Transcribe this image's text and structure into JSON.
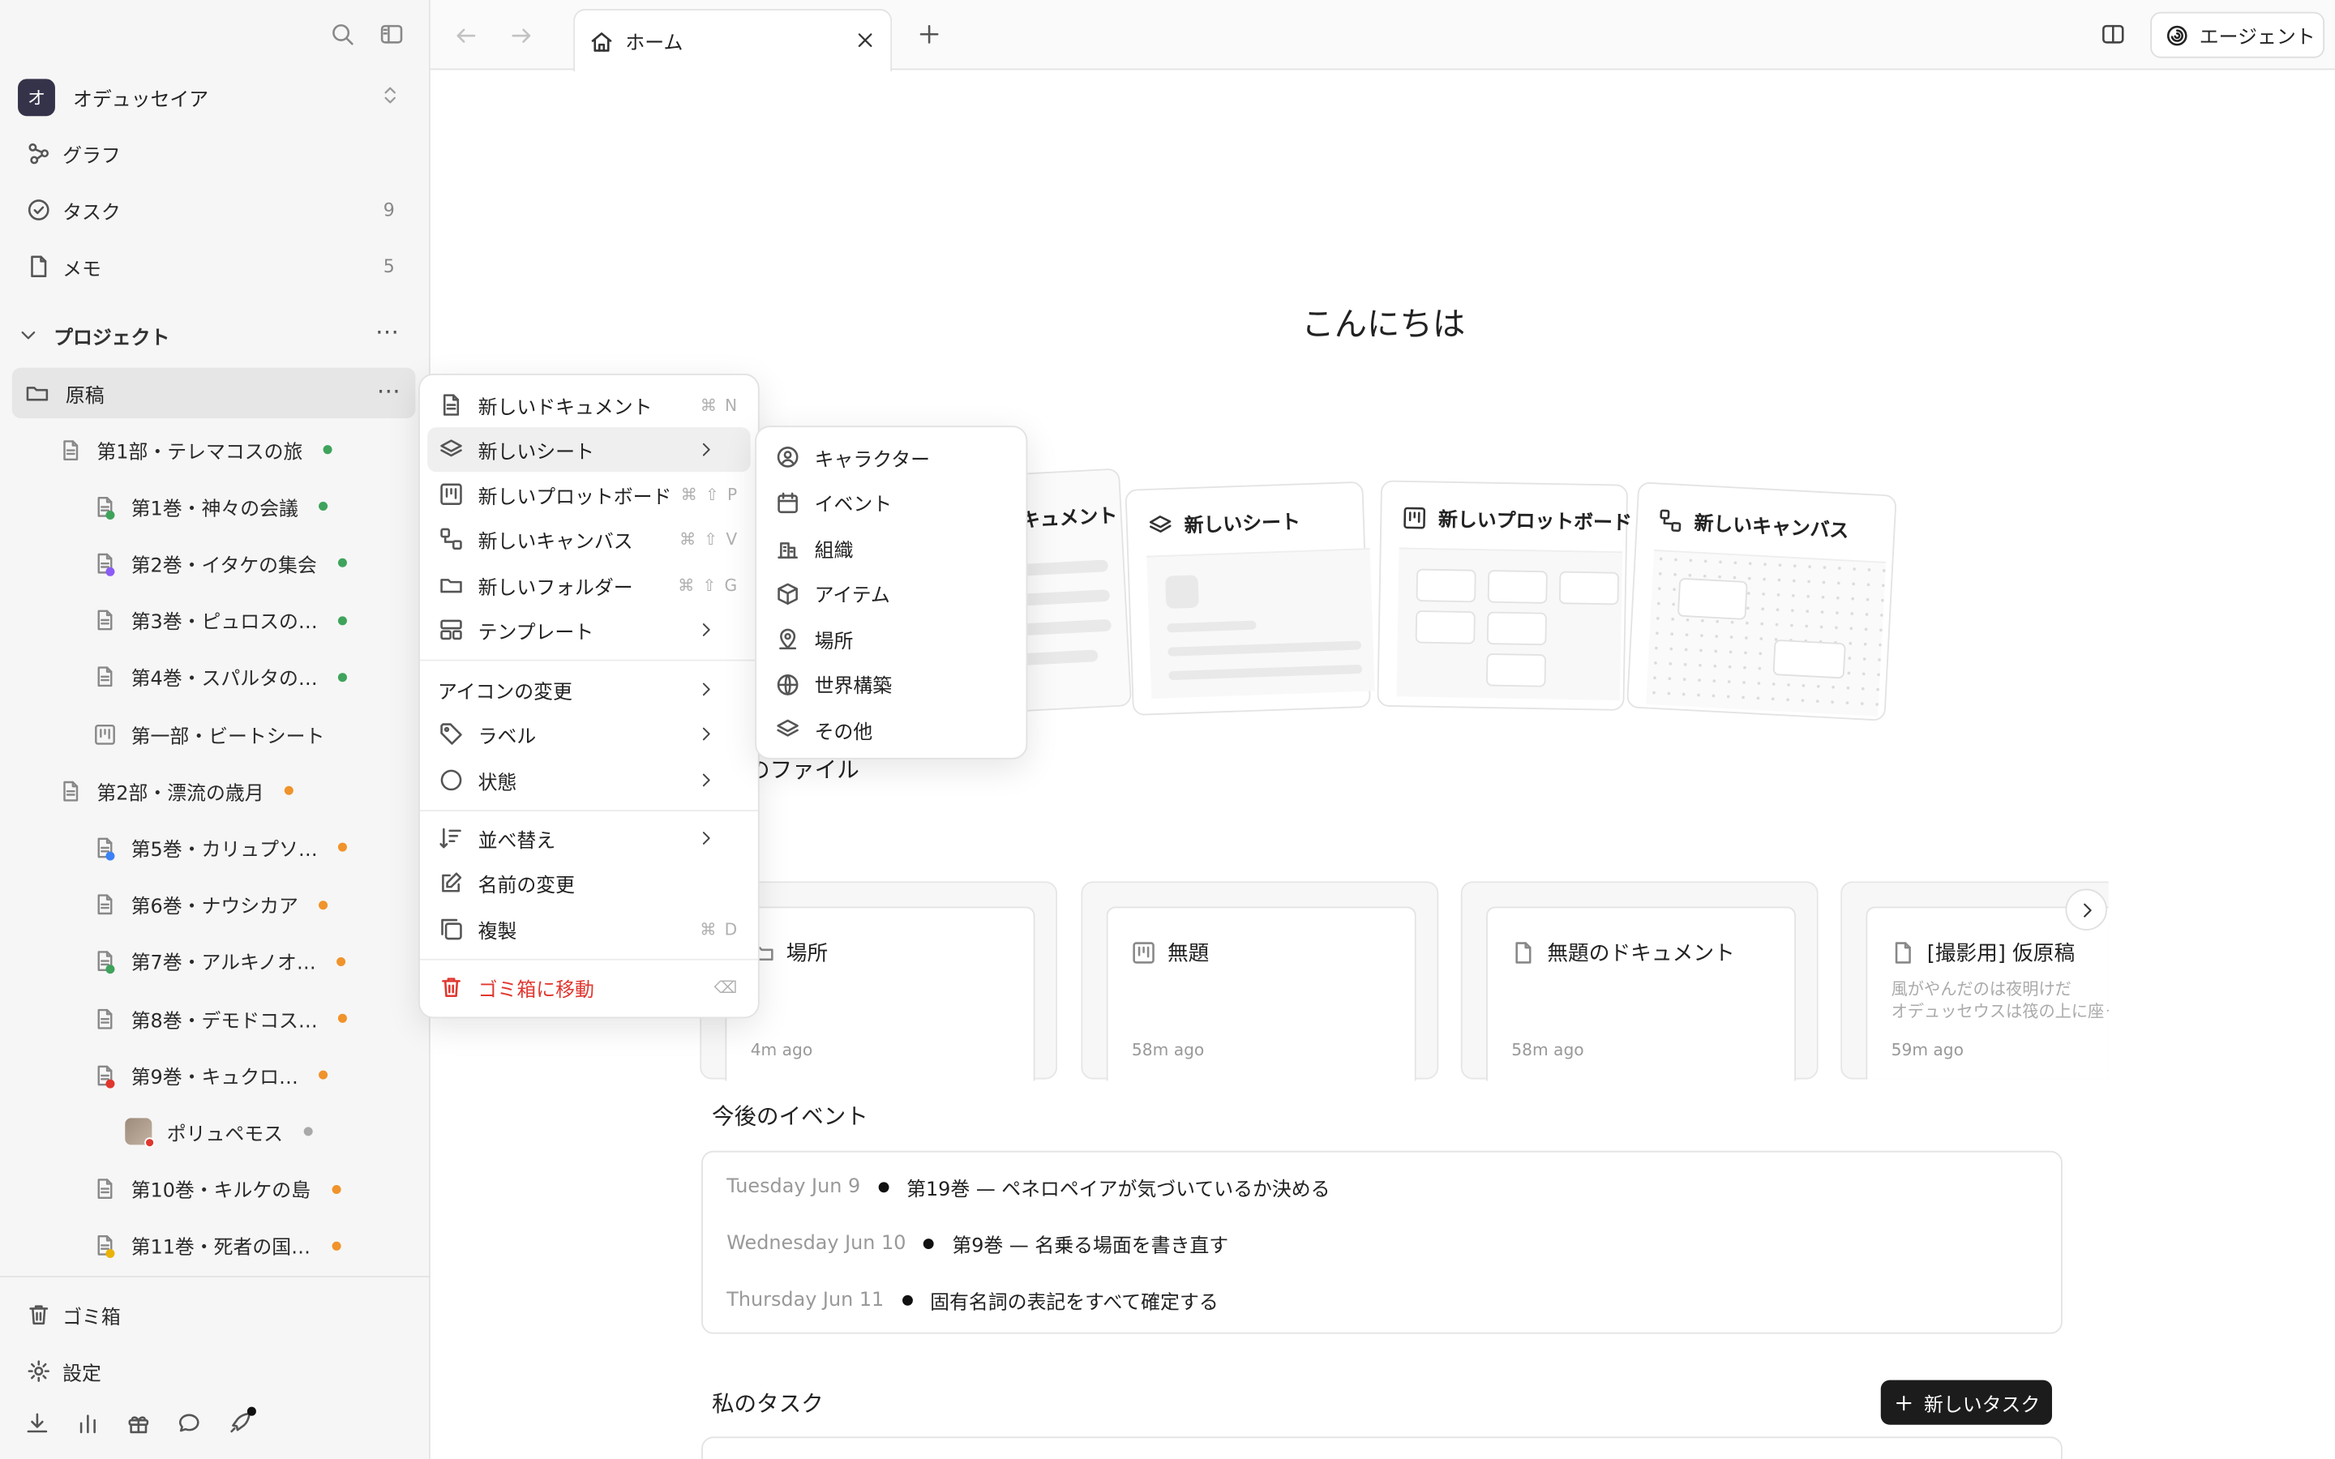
{
  "window": {
    "workspace_initial": "オ",
    "workspace_name": "オデュッセイア"
  },
  "sidebar": {
    "nav": [
      {
        "label": "グラフ",
        "icon": "graph-icon"
      },
      {
        "label": "タスク",
        "icon": "check-circle-icon",
        "count": "9"
      },
      {
        "label": "メモ",
        "icon": "note-icon",
        "count": "5"
      }
    ],
    "projects_label": "プロジェクト",
    "folder_label": "原稿",
    "tree": [
      {
        "label": "第1部・テレマコスの旅",
        "dot": "green"
      },
      {
        "label": "第1巻・神々の会議",
        "dot": "green"
      },
      {
        "label": "第2巻・イタケの集会",
        "dot": "green"
      },
      {
        "label": "第3巻・ピュロスの…",
        "dot": "green"
      },
      {
        "label": "第4巻・スパルタの…",
        "dot": "green"
      },
      {
        "label": "第一部・ビートシート",
        "dot": ""
      },
      {
        "label": "第2部・漂流の歳月",
        "dot": "orange"
      },
      {
        "label": "第5巻・カリュプソ…",
        "dot": "orange"
      },
      {
        "label": "第6巻・ナウシカア",
        "dot": "orange"
      },
      {
        "label": "第7巻・アルキノオ…",
        "dot": "orange"
      },
      {
        "label": "第8巻・デモドコス…",
        "dot": "orange"
      },
      {
        "label": "第9巻・キュクロ…",
        "dot": "orange"
      },
      {
        "label": "ポリュペモス",
        "dot": "gray"
      },
      {
        "label": "第10巻・キルケの島",
        "dot": "orange"
      },
      {
        "label": "第11巻・死者の国…",
        "dot": "orange"
      }
    ],
    "trash_label": "ゴミ箱",
    "settings_label": "設定"
  },
  "tabs": {
    "home_label": "ホーム",
    "agent_label": "エージェント"
  },
  "context_menu": {
    "items": [
      {
        "label": "新しいドキュメント",
        "shortcut": "⌘ N"
      },
      {
        "label": "新しいシート",
        "submenu": true
      },
      {
        "label": "新しいプロットボード",
        "shortcut": "⌘ ⇧ P"
      },
      {
        "label": "新しいキャンバス",
        "shortcut": "⌘ ⇧ V"
      },
      {
        "label": "新しいフォルダー",
        "shortcut": "⌘ ⇧ G"
      },
      {
        "label": "テンプレート",
        "submenu": true
      }
    ],
    "change_icon": "アイコンの変更",
    "label": "ラベル",
    "status": "状態",
    "sort": "並べ替え",
    "rename": "名前の変更",
    "duplicate": "複製",
    "duplicate_shortcut": "⌘ D",
    "trash": "ゴミ箱に移動",
    "trash_shortcut": "⌫"
  },
  "sheet_submenu": [
    "キャラクター",
    "イベント",
    "組織",
    "アイテム",
    "場所",
    "世界構築",
    "その他"
  ],
  "home": {
    "greeting": "こんにちは",
    "create_cards": [
      "ドキュメント",
      "新しいシート",
      "新しいプロットボード",
      "新しいキャンバス"
    ],
    "recent_label": "のファイル",
    "recent_files": [
      {
        "title": "場所",
        "time": "4m ago"
      },
      {
        "title": "無題",
        "time": "58m ago"
      },
      {
        "title": "無題のドキュメント",
        "time": "58m ago"
      },
      {
        "title": "[撮影用] 仮原稿",
        "time": "59m ago",
        "preview1": "風がやんだのは夜明けだ",
        "preview2": "オデュッセウスは筏の上に座っ"
      }
    ],
    "events_label": "今後のイベント",
    "events": [
      {
        "date": "Tuesday Jun 9",
        "title": "第19巻 — ペネロペイアが気づいているか決める"
      },
      {
        "date": "Wednesday Jun 10",
        "title": "第9巻 — 名乗る場面を書き直す"
      },
      {
        "date": "Thursday Jun 11",
        "title": "固有名詞の表記をすべて確定する"
      }
    ],
    "tasks_label": "私のタスク",
    "new_task_label": "新しいタスク"
  }
}
